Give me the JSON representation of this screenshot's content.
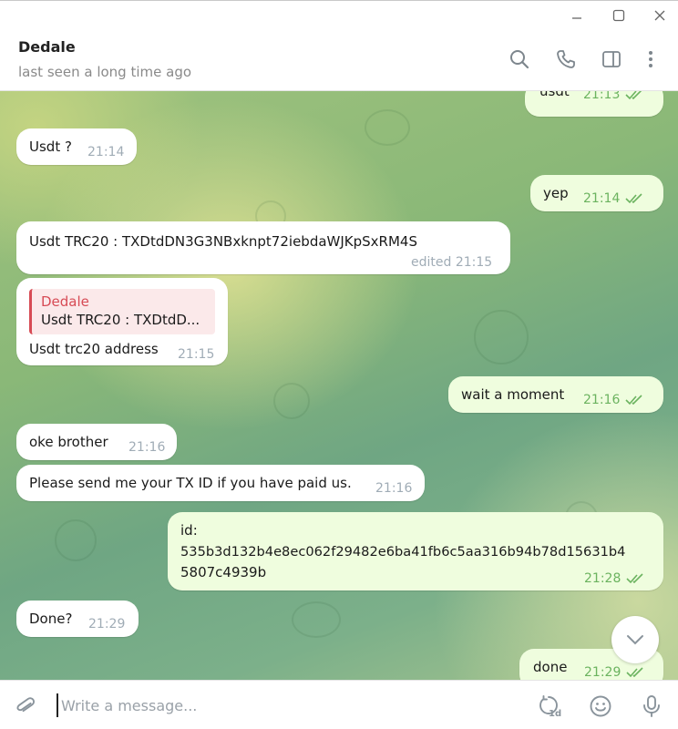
{
  "window": {
    "minimize": "minimize-icon",
    "maximize": "maximize-icon",
    "close": "close-icon"
  },
  "header": {
    "name": "Dedale",
    "status": "last seen a long time ago",
    "icons": [
      "search-icon",
      "phone-icon",
      "sidebar-icon",
      "more-icon"
    ]
  },
  "messages": [
    {
      "dir": "out",
      "text": "usdt",
      "time": "21:13",
      "read": true
    },
    {
      "dir": "in",
      "text": "Usdt ?",
      "time": "21:14"
    },
    {
      "dir": "out",
      "text": "yep",
      "time": "21:14",
      "read": true
    },
    {
      "dir": "in",
      "text": "Usdt TRC20 : TXDtdDN3G3NBxknpt72iebdaWJKpSxRM4S",
      "time": "edited 21:15"
    },
    {
      "dir": "in",
      "reply_name": "Dedale",
      "reply_text": "Usdt TRC20 : TXDtdD...",
      "text": "Usdt trc20 address",
      "time": "21:15"
    },
    {
      "dir": "out",
      "text": "wait a moment",
      "time": "21:16",
      "read": true
    },
    {
      "dir": "in",
      "text": "oke brother",
      "time": "21:16"
    },
    {
      "dir": "in",
      "text": "Please send me your TX ID if you have paid us.",
      "time": "21:16"
    },
    {
      "dir": "out",
      "text_line1": "id:",
      "text_line2": "535b3d132b4e8ec062f29482e6ba41fb6c5aa316b94b78d15631b4",
      "text_line3": "5807c4939b",
      "time": "21:28",
      "read": true
    },
    {
      "dir": "in",
      "text": "Done?",
      "time": "21:29"
    },
    {
      "dir": "out",
      "text": "done",
      "time": "21:29",
      "read": true
    }
  ],
  "composer": {
    "placeholder": "Write a message...",
    "timer_badge": "1d",
    "icons": [
      "attach-icon",
      "timer-icon",
      "emoji-icon",
      "microphone-icon"
    ]
  },
  "colors": {
    "accent_green": "#6bb35f",
    "reply_red": "#d74b55",
    "out_bubble": "#effdde"
  }
}
